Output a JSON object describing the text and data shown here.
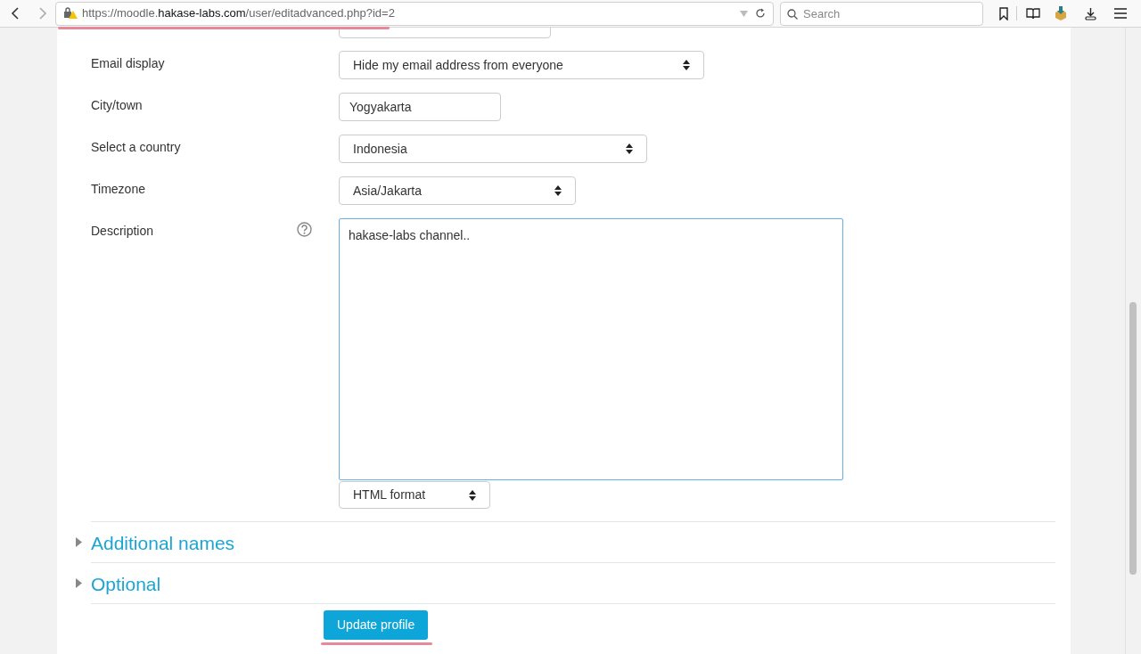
{
  "browser": {
    "url_host_prefix": "https://moodle.",
    "url_host": "hakase-labs.com",
    "url_path": "/user/editadvanced.php?id=2",
    "url_highlighted": true,
    "search_placeholder": "Search"
  },
  "fields": [
    {
      "kind": "select",
      "label": "Email display",
      "value": "Hide my email address from everyone",
      "help": false
    },
    {
      "kind": "text",
      "label": "City/town",
      "value": "Yogyakarta",
      "help": false
    },
    {
      "kind": "select",
      "label": "Select a country",
      "value": "Indonesia",
      "help": false
    },
    {
      "kind": "select",
      "label": "Timezone",
      "value": "Asia/Jakarta",
      "help": false
    },
    {
      "kind": "textarea",
      "label": "Description",
      "value": "hakase-labs channel..",
      "help": true,
      "format": "HTML format"
    }
  ],
  "sections": [
    {
      "title": "Additional names",
      "expanded": false
    },
    {
      "title": "Optional",
      "expanded": false
    }
  ],
  "submit": {
    "label": "Update profile",
    "highlighted": true
  }
}
